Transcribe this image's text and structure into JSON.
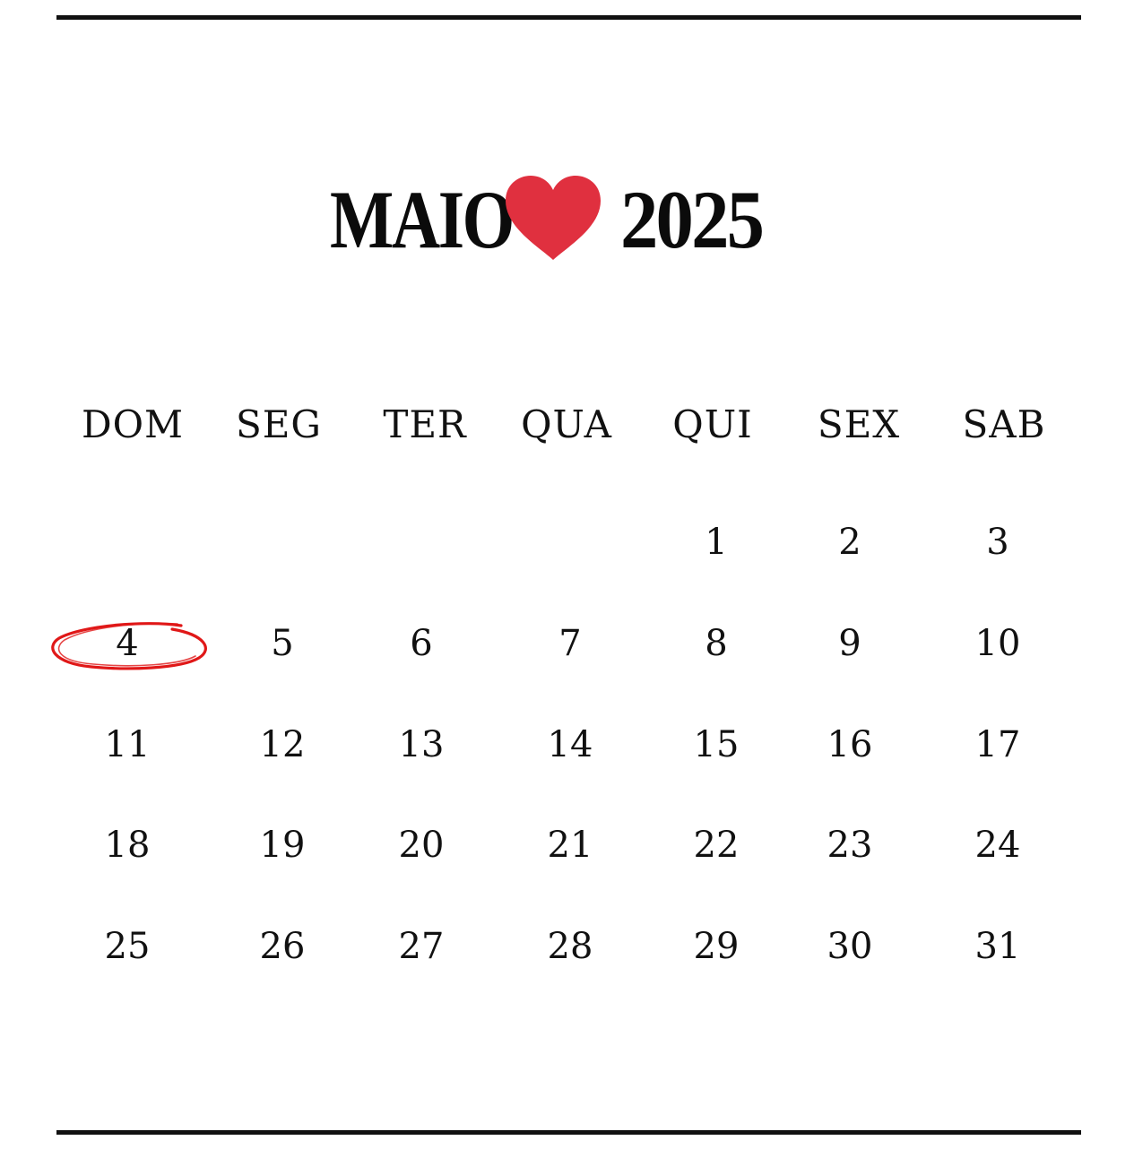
{
  "title": {
    "month": "MAIO",
    "year": "2025",
    "heart_icon": "heart-icon",
    "heart_color": "#e0303f"
  },
  "weekdays": [
    "DOM",
    "SEG",
    "TER",
    "QUA",
    "QUI",
    "SEX",
    "SAB"
  ],
  "days": [
    "1",
    "2",
    "3",
    "4",
    "5",
    "6",
    "7",
    "8",
    "9",
    "10",
    "11",
    "12",
    "13",
    "14",
    "15",
    "16",
    "17",
    "18",
    "19",
    "20",
    "21",
    "22",
    "23",
    "24",
    "25",
    "26",
    "27",
    "28",
    "29",
    "30",
    "31"
  ],
  "first_weekday_index": 4,
  "highlighted_day": "4",
  "highlight_color": "#e01818"
}
